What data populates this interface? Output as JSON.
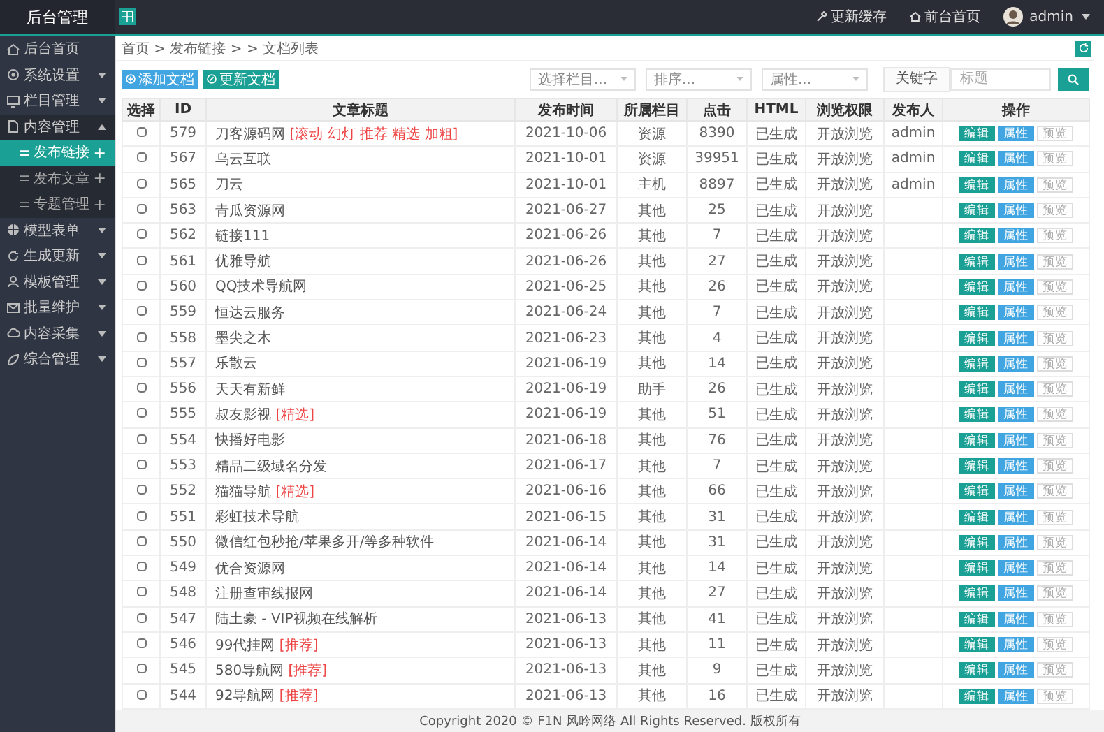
{
  "header": {
    "title": "后台管理",
    "links": [
      {
        "label": "更新缓存"
      },
      {
        "label": "前台首页"
      }
    ],
    "user": "admin"
  },
  "sidebar": {
    "items": [
      {
        "label": "后台首页",
        "selected": false
      },
      {
        "label": "系统设置",
        "expanded": false,
        "selected": false
      },
      {
        "label": "栏目管理",
        "expanded": false,
        "selected": false
      },
      {
        "label": "内容管理",
        "expanded": true,
        "selected": false,
        "children": [
          {
            "label": "发布链接",
            "action": "+",
            "selected": true
          },
          {
            "label": "发布文章",
            "action": "+",
            "selected": false
          },
          {
            "label": "专题管理",
            "action": "+",
            "selected": false
          }
        ]
      },
      {
        "label": "模型表单",
        "expanded": false,
        "selected": false
      },
      {
        "label": "生成更新",
        "expanded": false,
        "selected": false
      },
      {
        "label": "模板管理",
        "expanded": false,
        "selected": false
      },
      {
        "label": "批量维护",
        "expanded": false,
        "selected": false
      },
      {
        "label": "内容采集",
        "expanded": false,
        "selected": false
      },
      {
        "label": "综合管理",
        "expanded": false,
        "selected": false
      }
    ]
  },
  "breadcrumb": "首页 > 发布链接 > > 文档列表",
  "toolbar": {
    "buttons": [
      {
        "label": "添加文档",
        "kind": "add"
      },
      {
        "label": "更新文档",
        "kind": "update"
      }
    ],
    "selects": [
      {
        "value": "选择栏目..."
      },
      {
        "value": "排序..."
      },
      {
        "value": "属性..."
      }
    ],
    "keyword_label": "关键字",
    "search": {
      "placeholder": "标题"
    }
  },
  "table": {
    "columns": [
      "选择",
      "ID",
      "文章标题",
      "发布时间",
      "所属栏目",
      "点击",
      "HTML",
      "浏览权限",
      "发布人",
      "操作"
    ],
    "rows": [
      {
        "checked": false,
        "id": "579",
        "title": "刀客源码网",
        "tag": "[滚动 幻灯 推荐 精选 加粗]",
        "date": "2021-10-06",
        "column": "资源",
        "clicks": "8390",
        "html": "已生成",
        "access": "开放浏览",
        "author": "admin",
        "actions": [
          "编辑",
          "属性",
          "预览"
        ]
      },
      {
        "checked": false,
        "id": "567",
        "title": "乌云互联",
        "date": "2021-10-01",
        "column": "资源",
        "clicks": "39951",
        "html": "已生成",
        "access": "开放浏览",
        "author": "admin",
        "actions": [
          "编辑",
          "属性",
          "预览"
        ]
      },
      {
        "checked": false,
        "id": "565",
        "title": "刀云",
        "date": "2021-10-01",
        "column": "主机",
        "clicks": "8897",
        "html": "已生成",
        "access": "开放浏览",
        "author": "admin",
        "actions": [
          "编辑",
          "属性",
          "预览"
        ]
      },
      {
        "checked": false,
        "id": "563",
        "title": "青瓜资源网",
        "date": "2021-06-27",
        "column": "其他",
        "clicks": "25",
        "html": "已生成",
        "access": "开放浏览",
        "actions": [
          "编辑",
          "属性",
          "预览"
        ]
      },
      {
        "checked": false,
        "id": "562",
        "title": "链接111",
        "date": "2021-06-26",
        "column": "其他",
        "clicks": "7",
        "html": "已生成",
        "access": "开放浏览",
        "actions": [
          "编辑",
          "属性",
          "预览"
        ]
      },
      {
        "checked": false,
        "id": "561",
        "title": "优雅导航",
        "date": "2021-06-26",
        "column": "其他",
        "clicks": "27",
        "html": "已生成",
        "access": "开放浏览",
        "actions": [
          "编辑",
          "属性",
          "预览"
        ]
      },
      {
        "checked": false,
        "id": "560",
        "title": "QQ技术导航网",
        "date": "2021-06-25",
        "column": "其他",
        "clicks": "26",
        "html": "已生成",
        "access": "开放浏览",
        "actions": [
          "编辑",
          "属性",
          "预览"
        ]
      },
      {
        "checked": false,
        "id": "559",
        "title": "恒达云服务",
        "date": "2021-06-24",
        "column": "其他",
        "clicks": "7",
        "html": "已生成",
        "access": "开放浏览",
        "actions": [
          "编辑",
          "属性",
          "预览"
        ]
      },
      {
        "checked": false,
        "id": "558",
        "title": "墨尖之木",
        "date": "2021-06-23",
        "column": "其他",
        "clicks": "4",
        "html": "已生成",
        "access": "开放浏览",
        "actions": [
          "编辑",
          "属性",
          "预览"
        ]
      },
      {
        "checked": false,
        "id": "557",
        "title": "乐散云",
        "date": "2021-06-19",
        "column": "其他",
        "clicks": "14",
        "html": "已生成",
        "access": "开放浏览",
        "actions": [
          "编辑",
          "属性",
          "预览"
        ]
      },
      {
        "checked": false,
        "id": "556",
        "title": "天天有新鲜",
        "date": "2021-06-19",
        "column": "助手",
        "clicks": "26",
        "html": "已生成",
        "access": "开放浏览",
        "actions": [
          "编辑",
          "属性",
          "预览"
        ]
      },
      {
        "checked": false,
        "id": "555",
        "title": "叔友影视",
        "tag": "[精选]",
        "date": "2021-06-19",
        "column": "其他",
        "clicks": "51",
        "html": "已生成",
        "access": "开放浏览",
        "actions": [
          "编辑",
          "属性",
          "预览"
        ]
      },
      {
        "checked": false,
        "id": "554",
        "title": "快播好电影",
        "date": "2021-06-18",
        "column": "其他",
        "clicks": "76",
        "html": "已生成",
        "access": "开放浏览",
        "actions": [
          "编辑",
          "属性",
          "预览"
        ]
      },
      {
        "checked": false,
        "id": "553",
        "title": "精品二级域名分发",
        "date": "2021-06-17",
        "column": "其他",
        "clicks": "7",
        "html": "已生成",
        "access": "开放浏览",
        "actions": [
          "编辑",
          "属性",
          "预览"
        ]
      },
      {
        "checked": false,
        "id": "552",
        "title": "猫猫导航",
        "tag": "[精选]",
        "date": "2021-06-16",
        "column": "其他",
        "clicks": "66",
        "html": "已生成",
        "access": "开放浏览",
        "actions": [
          "编辑",
          "属性",
          "预览"
        ]
      },
      {
        "checked": false,
        "id": "551",
        "title": "彩虹技术导航",
        "date": "2021-06-15",
        "column": "其他",
        "clicks": "31",
        "html": "已生成",
        "access": "开放浏览",
        "actions": [
          "编辑",
          "属性",
          "预览"
        ]
      },
      {
        "checked": false,
        "id": "550",
        "title": "微信红包秒抢/苹果多开/等多种软件",
        "date": "2021-06-14",
        "column": "其他",
        "clicks": "31",
        "html": "已生成",
        "access": "开放浏览",
        "actions": [
          "编辑",
          "属性",
          "预览"
        ]
      },
      {
        "checked": false,
        "id": "549",
        "title": "优合资源网",
        "date": "2021-06-14",
        "column": "其他",
        "clicks": "14",
        "html": "已生成",
        "access": "开放浏览",
        "actions": [
          "编辑",
          "属性",
          "预览"
        ]
      },
      {
        "checked": false,
        "id": "548",
        "title": "注册查审线报网",
        "date": "2021-06-14",
        "column": "其他",
        "clicks": "27",
        "html": "已生成",
        "access": "开放浏览",
        "actions": [
          "编辑",
          "属性",
          "预览"
        ]
      },
      {
        "checked": false,
        "id": "547",
        "title": "陆土豪 - VIP视频在线解析",
        "date": "2021-06-13",
        "column": "其他",
        "clicks": "41",
        "html": "已生成",
        "access": "开放浏览",
        "actions": [
          "编辑",
          "属性",
          "预览"
        ]
      },
      {
        "checked": false,
        "id": "546",
        "title": "99代挂网",
        "tag": "[推荐]",
        "date": "2021-06-13",
        "column": "其他",
        "clicks": "11",
        "html": "已生成",
        "access": "开放浏览",
        "actions": [
          "编辑",
          "属性",
          "预览"
        ]
      },
      {
        "checked": false,
        "id": "545",
        "title": "580导航网",
        "tag": "[推荐]",
        "date": "2021-06-13",
        "column": "其他",
        "clicks": "9",
        "html": "已生成",
        "access": "开放浏览",
        "actions": [
          "编辑",
          "属性",
          "预览"
        ]
      },
      {
        "checked": false,
        "id": "544",
        "title": "92导航网",
        "tag": "[推荐]",
        "date": "2021-06-13",
        "column": "其他",
        "clicks": "16",
        "html": "已生成",
        "access": "开放浏览",
        "actions": [
          "编辑",
          "属性",
          "预览"
        ]
      }
    ]
  },
  "footer": "Copyright 2020 © F1N 风吟网络 All Rights Reserved. 版权所有"
}
